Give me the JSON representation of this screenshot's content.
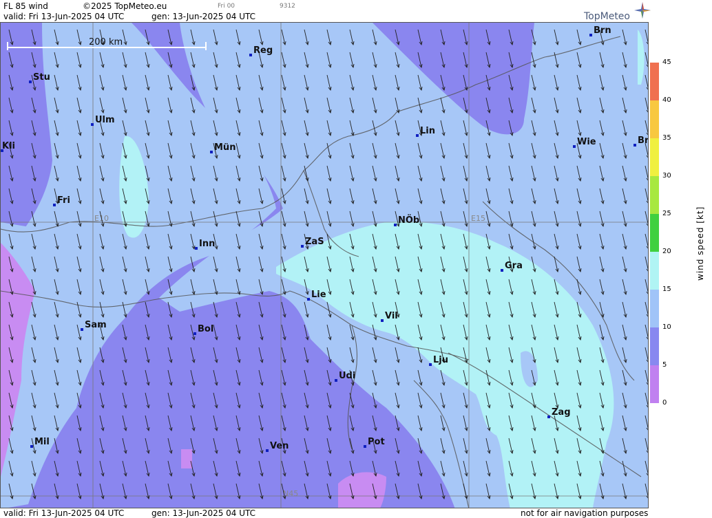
{
  "header": {
    "product": "FL 85 wind",
    "copyright": "©2025 TopMeteo.eu",
    "valid": "valid:  Fri  13-Jun-2025  04 UTC",
    "generated": "gen: 13-Jun-2025  04 UTC",
    "run_label": "Fri 00",
    "run_code": "9312",
    "logo_text": "TopMeteo"
  },
  "footer": {
    "valid": "valid:  Fri  13-Jun-2025  04 UTC",
    "generated": "gen: 13-Jun-2025  04 UTC",
    "disclaimer": "not for air navigation purposes"
  },
  "map": {
    "scale_label": "200 km",
    "grid_labels": [
      "E10",
      "E15",
      "N45"
    ],
    "cities": [
      {
        "name": "Stu"
      },
      {
        "name": "Reg"
      },
      {
        "name": "Brn"
      },
      {
        "name": "Ulm"
      },
      {
        "name": "Kli"
      },
      {
        "name": "Mün"
      },
      {
        "name": "Lin"
      },
      {
        "name": "Wie"
      },
      {
        "name": "Br"
      },
      {
        "name": "Fri"
      },
      {
        "name": "NÖb"
      },
      {
        "name": "Inn"
      },
      {
        "name": "ZaS"
      },
      {
        "name": "Gra"
      },
      {
        "name": "Lie"
      },
      {
        "name": "Vil"
      },
      {
        "name": "Sam"
      },
      {
        "name": "Bol"
      },
      {
        "name": "Lju"
      },
      {
        "name": "Udi"
      },
      {
        "name": "Zag"
      },
      {
        "name": "Mil"
      },
      {
        "name": "Ven"
      },
      {
        "name": "Pot"
      }
    ],
    "wind_direction": "north to north-northwest (arrows pointing south)"
  },
  "legend": {
    "title": "wind speed  [kt]",
    "ticks": [
      "45",
      "40",
      "35",
      "30",
      "25",
      "20",
      "15",
      "10",
      "5",
      "0"
    ],
    "bands": [
      {
        "from": 0,
        "to": 5,
        "color": "#c080f0"
      },
      {
        "from": 5,
        "to": 10,
        "color": "#8888f0"
      },
      {
        "from": 10,
        "to": 15,
        "color": "#a0c4f8"
      },
      {
        "from": 15,
        "to": 20,
        "color": "#b0f4f4"
      },
      {
        "from": 20,
        "to": 25,
        "color": "#40d040"
      },
      {
        "from": 25,
        "to": 30,
        "color": "#a8e840"
      },
      {
        "from": 30,
        "to": 35,
        "color": "#f0f040"
      },
      {
        "from": 35,
        "to": 40,
        "color": "#f8c840"
      },
      {
        "from": 40,
        "to": 45,
        "color": "#f07050"
      }
    ]
  },
  "colors": {
    "calm": "#8a86ef",
    "light": "#a7c7f7",
    "moderate": "#b2f2f6",
    "very_light": "#c88cf2"
  }
}
